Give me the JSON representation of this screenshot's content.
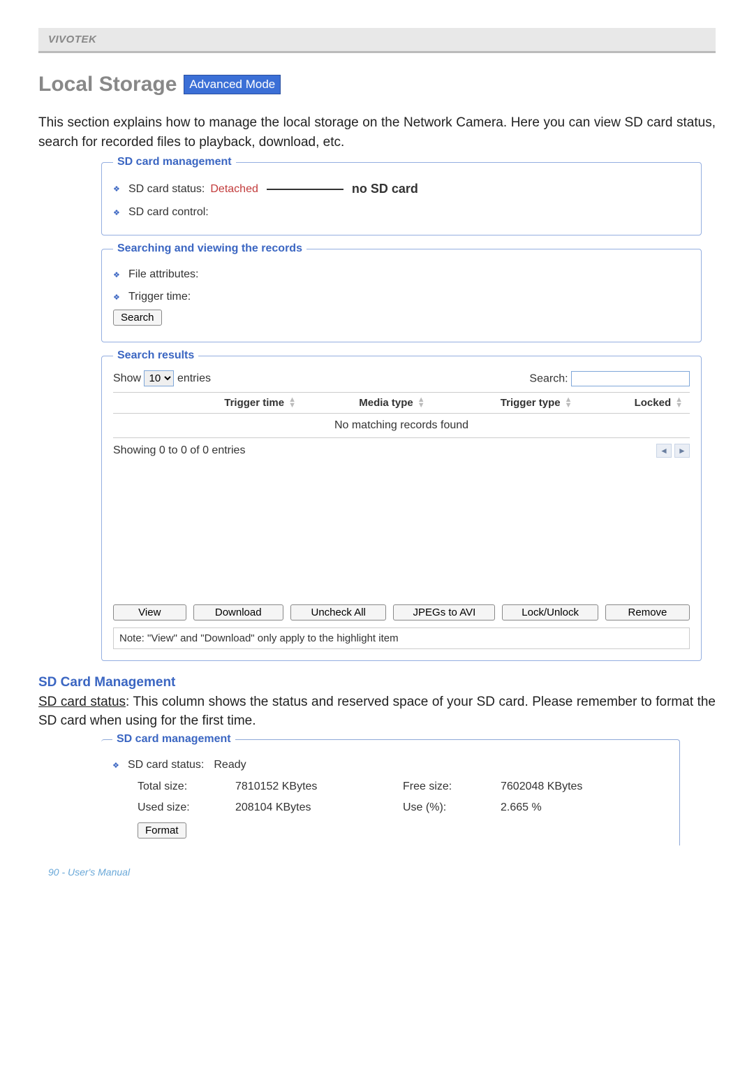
{
  "header_brand": "VIVOTEK",
  "page_title": "Local Storage",
  "adv_badge": "Advanced Mode",
  "intro_text": "This section explains how to manage the local storage on the Network Camera. Here you can view SD card status, search for recorded files to playback, download, etc.",
  "sd_mgmt": {
    "legend": "SD card management",
    "status_label": "SD card status:",
    "status_value": "Detached",
    "status_annot": "no SD card",
    "control_label": "SD card control:"
  },
  "search_view": {
    "legend": "Searching and viewing the records",
    "file_attr": "File attributes:",
    "trigger_time": "Trigger time:",
    "search_btn": "Search"
  },
  "results": {
    "legend": "Search results",
    "show": "Show",
    "entries": "entries",
    "entries_value": "10",
    "search_label": "Search:",
    "columns": [
      "Trigger time",
      "Media type",
      "Trigger type",
      "Locked"
    ],
    "no_match": "No matching records found",
    "showing": "Showing 0 to 0 of 0 entries"
  },
  "actions": {
    "view": "View",
    "download": "Download",
    "uncheck": "Uncheck All",
    "jpegs": "JPEGs to AVI",
    "lock": "Lock/Unlock",
    "remove": "Remove"
  },
  "note": "Note: \"View\" and \"Download\" only apply to the highlight item",
  "section2": {
    "heading": "SD Card Management",
    "status_term": "SD card status",
    "body": ": This column shows the status and reserved space of your SD card. Please remember to format the SD card when using for the first time."
  },
  "sd_ready": {
    "legend": "SD card management",
    "status_label": "SD card status:",
    "status_value": "Ready",
    "total_lbl": "Total size:",
    "total_val": "7810152 KBytes",
    "free_lbl": "Free size:",
    "free_val": "7602048 KBytes",
    "used_lbl": "Used size:",
    "used_val": "208104 KBytes",
    "usep_lbl": "Use (%):",
    "usep_val": "2.665 %",
    "format_btn": "Format"
  },
  "footer": "90 - User's Manual"
}
